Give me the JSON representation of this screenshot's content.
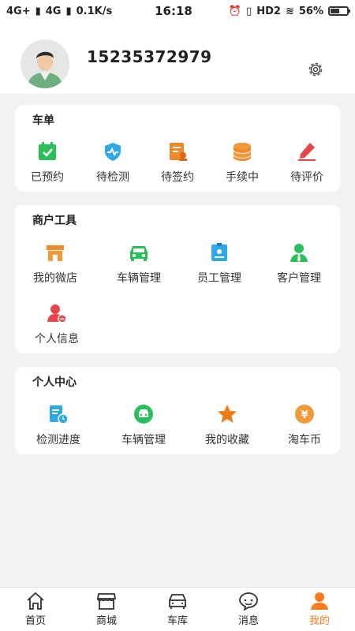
{
  "status_bar": {
    "signal1": "4G+",
    "signal2": "4G",
    "net_speed": "0.1K/s",
    "time": "16:18",
    "hd": "HD2",
    "battery": "56%",
    "battery_level": 0.56
  },
  "profile": {
    "phone": "15235372979"
  },
  "orders": {
    "title": "车单",
    "items": [
      "已预约",
      "待检测",
      "待签约",
      "手续中",
      "待评价"
    ]
  },
  "merchant_tools": {
    "title": "商户工具",
    "items": [
      "我的微店",
      "车辆管理",
      "员工管理",
      "客户管理",
      "个人信息"
    ]
  },
  "personal_center": {
    "title": "个人中心",
    "items": [
      "检测进度",
      "车辆管理",
      "我的收藏",
      "淘车币"
    ]
  },
  "tabbar": {
    "items": [
      "首页",
      "商城",
      "车库",
      "消息",
      "我的"
    ],
    "active": "我的"
  },
  "colors": {
    "accent": "#ff7a1a",
    "green": "#2bbf5c",
    "blue": "#2ea8e6",
    "orange": "#f08a2a",
    "red": "#e8454a"
  }
}
